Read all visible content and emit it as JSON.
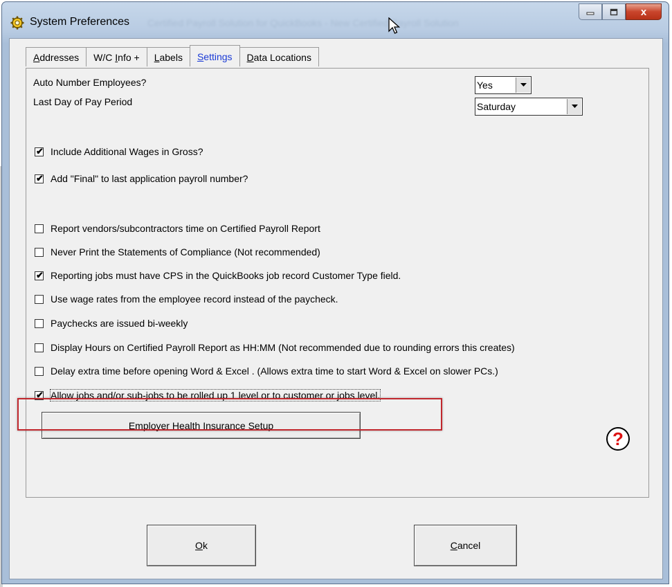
{
  "window": {
    "title": "System Preferences",
    "background_title": "Certified Payroll Solution for QuickBooks - New Certified Payroll Solution",
    "close_symbol": "x"
  },
  "tabs": [
    {
      "label": "Addresses",
      "accel": "A",
      "rest": "ddresses"
    },
    {
      "label": "W/C Info +",
      "pre": "W/C ",
      "accel": "I",
      "rest": "nfo +"
    },
    {
      "label": "Labels",
      "accel": "L",
      "rest": "abels"
    },
    {
      "label": "Settings",
      "accel": "S",
      "rest": "ettings"
    },
    {
      "label": "Data Locations",
      "accel": "D",
      "rest": "ata Locations"
    }
  ],
  "active_tab": "Settings",
  "settings": {
    "auto_number_label": "Auto Number Employees?",
    "auto_number_value": "Yes",
    "last_day_label": "Last Day of Pay Period",
    "last_day_value": "Saturday"
  },
  "checkboxes": [
    {
      "label": "Include Additional Wages in Gross?",
      "checked": true
    },
    {
      "label": "Add \"Final\" to last application payroll number?",
      "checked": true
    },
    {
      "label": "Report vendors/subcontractors time on Certified Payroll Report",
      "checked": false
    },
    {
      "label": "Never Print the Statements of Compliance (Not recommended)",
      "checked": false
    },
    {
      "label": "Reporting jobs must have CPS in the QuickBooks job record Customer Type field.",
      "checked": true
    },
    {
      "label": "Use wage rates from the employee record instead of the paycheck.",
      "checked": false
    },
    {
      "label": "Paychecks are issued bi-weekly",
      "checked": false
    },
    {
      "label": "Display Hours on Certified Payroll Report as HH:MM (Not recommended due to rounding errors  this creates)",
      "checked": false
    },
    {
      "label": "Delay extra time before opening Word & Excel . (Allows extra time to start Word  & Excel on slower PCs.)",
      "checked": false
    },
    {
      "label": "Allow jobs and/or sub-jobs to be rolled up 1 level or to customer or jobs level.",
      "checked": true
    }
  ],
  "buttons": {
    "health_insurance": "Employer Health Insurance Setup",
    "ok_accel": "O",
    "ok_rest": "k",
    "cancel_accel": "C",
    "cancel_rest": "ancel",
    "help_symbol": "?"
  },
  "colors": {
    "active_tab_text": "#1a3ad6",
    "highlight_box": "#c1272d",
    "help_icon": "#d11111"
  }
}
